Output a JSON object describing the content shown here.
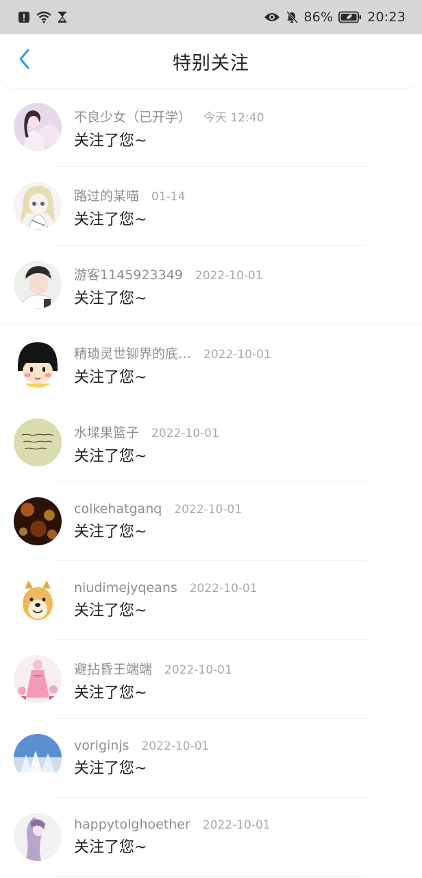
{
  "status_bar": {
    "battery": "86%",
    "time": "20:23",
    "left_icons": [
      "alert-icon",
      "wifi-icon",
      "hourglass-icon"
    ],
    "right_icons": [
      "eye-icon",
      "bell-off-icon",
      "battery-icon"
    ]
  },
  "header": {
    "title": "特别关注",
    "back_icon": "chevron-left-icon",
    "accent": "#2a9df4"
  },
  "notifications": [
    {
      "name": "不良少女（已开学）",
      "time": "今天 12:40",
      "message": "关注了您~"
    },
    {
      "name": "路过的某喵",
      "time": "01-14",
      "message": "关注了您~"
    },
    {
      "name": "游客1145923349",
      "time": "2022-10-01",
      "message": "关注了您~"
    },
    {
      "name": "精琐灵世铆界的底…",
      "time": "2022-10-01",
      "message": "关注了您~"
    },
    {
      "name": "水墚果篮子",
      "time": "2022-10-01",
      "message": "关注了您~"
    },
    {
      "name": "colkehatganq",
      "time": "2022-10-01",
      "message": "关注了您~"
    },
    {
      "name": "niudimejyqeans",
      "time": "2022-10-01",
      "message": "关注了您~"
    },
    {
      "name": "避拈昏王端端",
      "time": "2022-10-01",
      "message": "关注了您~"
    },
    {
      "name": "voriginjs",
      "time": "2022-10-01",
      "message": "关注了您~"
    },
    {
      "name": "happytolghoether",
      "time": "2022-10-01",
      "message": "关注了您~"
    }
  ]
}
